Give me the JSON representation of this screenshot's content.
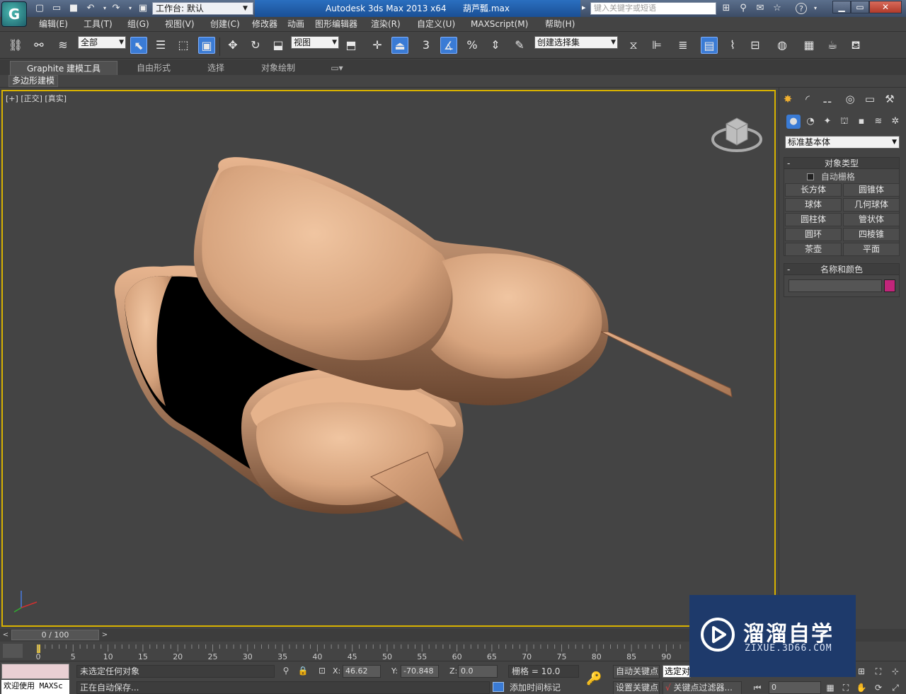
{
  "titlebar": {
    "workspace_label": "工作台: 默认",
    "app_name": "Autodesk 3ds Max  2013 x64",
    "file_name": "葫芦瓢.max",
    "search_placeholder": "键入关键字或短语",
    "close_label": "✕",
    "min_label": "▁",
    "max_label": "▭",
    "help_label": "?"
  },
  "menu": [
    "编辑(E)",
    "工具(T)",
    "组(G)",
    "视图(V)",
    "创建(C)",
    "修改器",
    "动画",
    "图形编辑器",
    "渲染(R)",
    "自定义(U)",
    "MAXScript(M)",
    "帮助(H)"
  ],
  "toolbar": {
    "selection_filter": "全部",
    "reference_coord": "视图",
    "named_selection": "创建选择集",
    "snap_value": "3"
  },
  "ribbon": {
    "tabs": [
      "Graphite 建模工具",
      "自由形式",
      "选择",
      "对象绘制"
    ],
    "sub_label": "多边形建模"
  },
  "viewport": {
    "label_plus": "[+]",
    "label_view": "[正交]",
    "label_shading": "[真实]",
    "model_color": "#d9a47d"
  },
  "command_panel": {
    "category": "标准基本体",
    "object_type_title": "对象类型",
    "autogrid_label": "自动栅格",
    "buttons": [
      "长方体",
      "圆锥体",
      "球体",
      "几何球体",
      "圆柱体",
      "管状体",
      "圆环",
      "四棱锥",
      "茶壶",
      "平面"
    ],
    "name_color_title": "名称和颜色",
    "object_color": "#c2257a"
  },
  "timeline": {
    "frame_display": "0 / 100",
    "ticks": [
      "0",
      "5",
      "10",
      "15",
      "20",
      "25",
      "30",
      "35",
      "40",
      "45",
      "50",
      "55",
      "60",
      "65",
      "70",
      "75",
      "80",
      "85",
      "90"
    ]
  },
  "status": {
    "welcome": "欢迎使用 MAXSc",
    "selection": "未选定任何对象",
    "prompt": "正在自动保存...",
    "x_label": "X:",
    "x_value": "46.62",
    "y_label": "Y:",
    "y_value": "-70.848",
    "z_label": "Z:",
    "z_value": "0.0",
    "grid": "栅格 = 10.0",
    "add_time_tag": "添加时间标记",
    "auto_key": "自动关键点",
    "set_key": "设置关键点",
    "selected_dropdown": "选定对",
    "key_filters": "关键点过滤器...",
    "frame_value": "0"
  },
  "watermark": {
    "title": "溜溜自学",
    "url": "ZIXUE.3D66.COM"
  }
}
